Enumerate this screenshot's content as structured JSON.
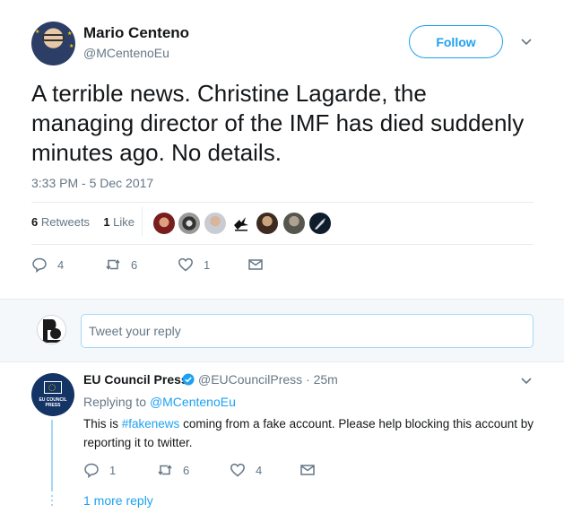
{
  "tweet": {
    "author_name": "Mario Centeno",
    "author_handle": "@MCentenoEu",
    "follow_label": "Follow",
    "text": "A terrible news. Christine Lagarde, the managing director of the IMF has died suddenly minutes ago. No details.",
    "timestamp": "3:33 PM - 5 Dec 2017",
    "retweets_count": "6",
    "retweets_label": "Retweets",
    "likes_count": "1",
    "likes_label": "Like",
    "actions": {
      "replies": "4",
      "retweets": "6",
      "likes": "1"
    }
  },
  "reply_box": {
    "placeholder": "Tweet your reply"
  },
  "reply": {
    "author_name": "EU Council Press",
    "author_handle": "@EUCouncilPress · 25m",
    "replying_prefix": "Replying to",
    "replying_to": "@MCentenoEu",
    "text_before": "This is ",
    "hashtag": "#fakenews",
    "text_after": " coming from a fake account. Please help blocking this account by reporting it to twitter.",
    "avatar_label": "EU COUNCIL PRESS",
    "actions": {
      "replies": "1",
      "retweets": "6",
      "likes": "4"
    },
    "more_replies": "1 more reply"
  },
  "colors": {
    "accent": "#1da1f2",
    "muted": "#657786",
    "text": "#14171a",
    "eu_blue": "#143466"
  }
}
